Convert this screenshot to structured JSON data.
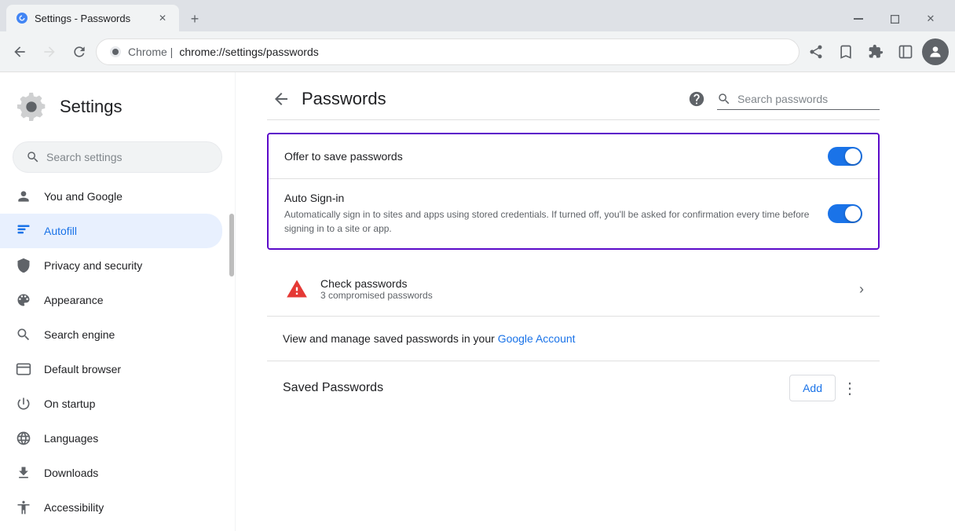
{
  "browser": {
    "tab_title": "Settings - Passwords",
    "favicon_label": "settings-favicon",
    "url_domain": "Chrome  |",
    "url_path": "chrome://settings/passwords",
    "new_tab_label": "+",
    "window_minimize": "—",
    "window_restore": "❐",
    "window_close": "✕"
  },
  "nav": {
    "back_disabled": false,
    "forward_disabled": true,
    "refresh_label": "↻"
  },
  "sidebar": {
    "title": "Settings",
    "search_placeholder": "Search settings",
    "items": [
      {
        "id": "you-and-google",
        "label": "You and Google",
        "icon": "person"
      },
      {
        "id": "autofill",
        "label": "Autofill",
        "icon": "autofill",
        "active": true
      },
      {
        "id": "privacy",
        "label": "Privacy and security",
        "icon": "shield"
      },
      {
        "id": "appearance",
        "label": "Appearance",
        "icon": "palette"
      },
      {
        "id": "search-engine",
        "label": "Search engine",
        "icon": "search"
      },
      {
        "id": "default-browser",
        "label": "Default browser",
        "icon": "browser"
      },
      {
        "id": "on-startup",
        "label": "On startup",
        "icon": "power"
      },
      {
        "id": "languages",
        "label": "Languages",
        "icon": "globe"
      },
      {
        "id": "downloads",
        "label": "Downloads",
        "icon": "download"
      },
      {
        "id": "accessibility",
        "label": "Accessibility",
        "icon": "accessibility"
      }
    ]
  },
  "passwords_page": {
    "back_label": "←",
    "title": "Passwords",
    "help_label": "?",
    "search_placeholder": "Search passwords",
    "offer_save": {
      "label": "Offer to save passwords",
      "toggle_on": true
    },
    "auto_signin": {
      "label": "Auto Sign-in",
      "description": "Automatically sign in to sites and apps using stored credentials. If turned off, you'll be asked for confirmation every time before signing in to a site or app.",
      "toggle_on": true
    },
    "check_passwords": {
      "title": "Check passwords",
      "subtitle": "3 compromised passwords"
    },
    "google_account_text": "View and manage saved passwords in your ",
    "google_account_link": "Google Account",
    "saved_passwords": {
      "label": "Saved Passwords",
      "add_label": "Add",
      "more_label": "⋮"
    }
  }
}
